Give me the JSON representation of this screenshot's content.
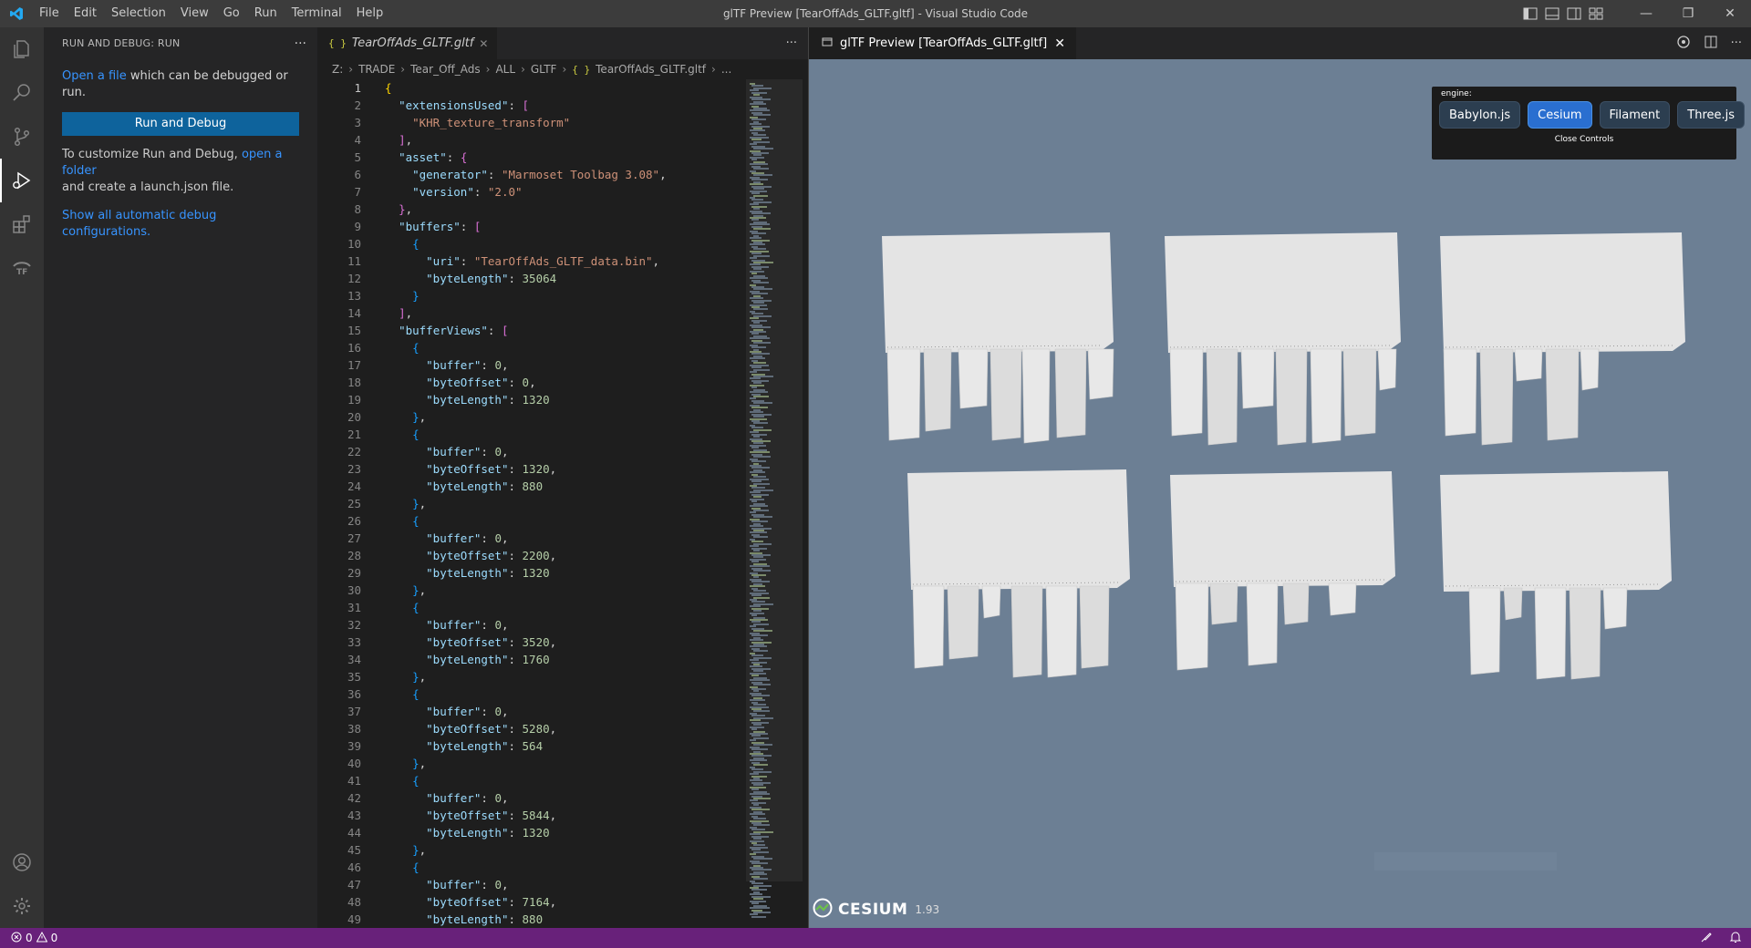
{
  "titlebar": {
    "window_title": "glTF Preview [TearOffAds_GLTF.gltf] - Visual Studio Code",
    "menu": [
      "File",
      "Edit",
      "Selection",
      "View",
      "Go",
      "Run",
      "Terminal",
      "Help"
    ]
  },
  "sidebar": {
    "header": "RUN AND DEBUG: RUN",
    "open_file_link": "Open a file",
    "open_file_rest": " which can be debugged or run.",
    "run_button": "Run and Debug",
    "customize_text": "To customize Run and Debug, ",
    "open_folder_link": "open a folder",
    "customize_rest": "and create a launch.json file.",
    "show_all_link": "Show all automatic debug configurations."
  },
  "editor": {
    "tab_label": "TearOffAds_GLTF.gltf",
    "breadcrumb": [
      "Z:",
      "TRADE",
      "Tear_Off_Ads",
      "ALL",
      "GLTF",
      "TearOffAds_GLTF.gltf",
      "..."
    ]
  },
  "code_lines": [
    "{",
    "  \"extensionsUsed\": [",
    "    \"KHR_texture_transform\"",
    "  ],",
    "  \"asset\": {",
    "    \"generator\": \"Marmoset Toolbag 3.08\",",
    "    \"version\": \"2.0\"",
    "  },",
    "  \"buffers\": [",
    "    {",
    "      \"uri\": \"TearOffAds_GLTF_data.bin\",",
    "      \"byteLength\": 35064",
    "    }",
    "  ],",
    "  \"bufferViews\": [",
    "    {",
    "      \"buffer\": 0,",
    "      \"byteOffset\": 0,",
    "      \"byteLength\": 1320",
    "    },",
    "    {",
    "      \"buffer\": 0,",
    "      \"byteOffset\": 1320,",
    "      \"byteLength\": 880",
    "    },",
    "    {",
    "      \"buffer\": 0,",
    "      \"byteOffset\": 2200,",
    "      \"byteLength\": 1320",
    "    },",
    "    {",
    "      \"buffer\": 0,",
    "      \"byteOffset\": 3520,",
    "      \"byteLength\": 1760",
    "    },",
    "    {",
    "      \"buffer\": 0,",
    "      \"byteOffset\": 5280,",
    "      \"byteLength\": 564",
    "    },",
    "    {",
    "      \"buffer\": 0,",
    "      \"byteOffset\": 5844,",
    "      \"byteLength\": 1320",
    "    },",
    "    {",
    "      \"buffer\": 0,",
    "      \"byteOffset\": 7164,",
    "      \"byteLength\": 880"
  ],
  "preview": {
    "tab_label": "glTF Preview [TearOffAds_GLTF.gltf]",
    "engine_label": "engine:",
    "engines": [
      "Babylon.js",
      "Cesium",
      "Filament",
      "Three.js"
    ],
    "selected_engine": "Cesium",
    "close_controls": "Close Controls",
    "cesium_brand": "CESIUM",
    "cesium_version": "1.93"
  },
  "statusbar": {
    "errors": "0",
    "warnings": "0"
  },
  "colors": {
    "accent": "#0e639c",
    "statusbar": "#68217a",
    "viewport_bg": "#6c7f94",
    "link": "#3794ff"
  }
}
